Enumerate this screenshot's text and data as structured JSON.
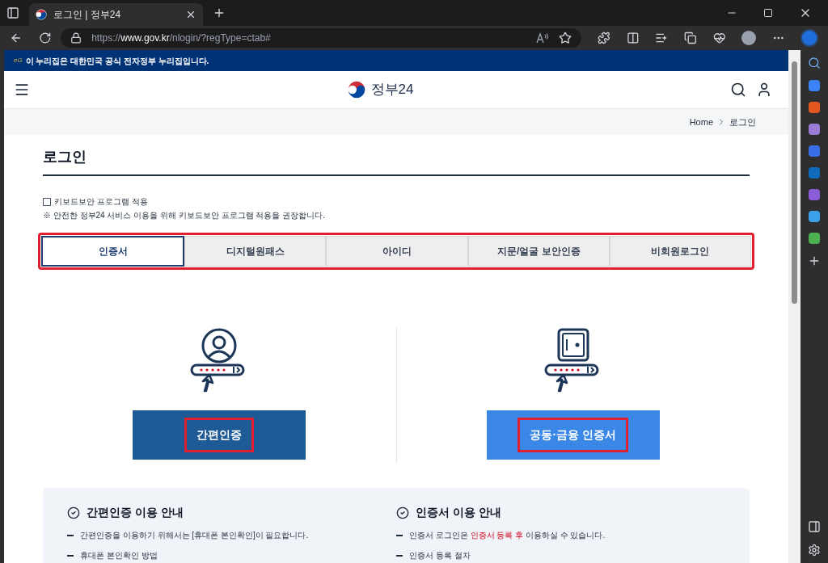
{
  "browser": {
    "tab_title": "로그인 | 정부24",
    "url_prefix": "https://",
    "url_host": "www.gov.kr",
    "url_path": "/nlogin/?regType=ctab#"
  },
  "banner": {
    "mark": "eG",
    "text": "이 누리집은 대한민국 공식 전자정부 누리집입니다."
  },
  "header": {
    "logo_text": "정부24"
  },
  "breadcrumb": [
    "Home",
    "로그인"
  ],
  "page_title": "로그인",
  "keyboard_security": {
    "label": "키보드보안 프로그램 적용",
    "checked": false,
    "note": "※ 안전한 정부24 서비스 이용을 위해 키보드보안 프로그램 적용을 권장합니다."
  },
  "tabs": [
    {
      "label": "인증서",
      "selected": true
    },
    {
      "label": "디지털원패스",
      "selected": false
    },
    {
      "label": "아이디",
      "selected": false
    },
    {
      "label": "지문/얼굴 보안인증",
      "selected": false
    },
    {
      "label": "비회원로그인",
      "selected": false
    }
  ],
  "login_options": [
    {
      "kind": "person",
      "button": "간편인증"
    },
    {
      "kind": "safe",
      "button": "공동·금융 인증서"
    }
  ],
  "guides": [
    {
      "title": "간편인증 이용 안내",
      "items": [
        {
          "parts": [
            "간편인증을 이용하기 위해서는 [휴대폰 본인확인]이 필요합니다."
          ]
        },
        {
          "parts": [
            "휴대폰 본인확인 방법"
          ]
        }
      ]
    },
    {
      "title": "인증서 이용 안내",
      "items": [
        {
          "parts": [
            "인증서 로그인은 ",
            "인증서 등록 후",
            " 이용하실 수 있습니다."
          ]
        },
        {
          "parts": [
            "인증서 등록 절차"
          ]
        }
      ]
    }
  ]
}
